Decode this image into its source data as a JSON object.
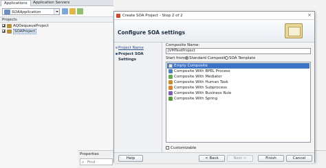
{
  "tabs": [
    "Applications",
    "Application Servers"
  ],
  "application_selector": {
    "value": "SOAApplication"
  },
  "projects_label": "Projects",
  "tree": [
    {
      "label": "AQDequeueProject",
      "selected": false
    },
    {
      "label": "SOAProject",
      "selected": true
    }
  ],
  "properties": {
    "title": "Properties",
    "find_placeholder": "Find"
  },
  "dialog": {
    "title": "Create SOA Project - Step 2 of 2",
    "close_glyph": "×",
    "banner_title": "Configure SOA settings",
    "nav": [
      {
        "label": "Project Name",
        "state": "link"
      },
      {
        "label": "Project SOA Settings",
        "state": "current"
      }
    ],
    "composite_name_label": "Composite Name:",
    "composite_name_value": "JVMTestProject",
    "start_from_label": "Start from:",
    "start_options": [
      {
        "label": "Standard Composite",
        "selected": true
      },
      {
        "label": "SOA Template",
        "selected": false
      }
    ],
    "composites": [
      {
        "label": "Empty Composite",
        "selected": true,
        "icon": "empty-composite-icon",
        "color": "#e8e8e8"
      },
      {
        "label": "Composite With BPEL Process",
        "selected": false,
        "icon": "bpel-icon",
        "color": "#4f7fbf"
      },
      {
        "label": "Composite With Mediator",
        "selected": false,
        "icon": "mediator-icon",
        "color": "#6aa84f"
      },
      {
        "label": "Composite With Human Task",
        "selected": false,
        "icon": "human-task-icon",
        "color": "#c98b2e"
      },
      {
        "label": "Composite With Subprocess",
        "selected": false,
        "icon": "subprocess-icon",
        "color": "#d9822b"
      },
      {
        "label": "Composite With Business Rule",
        "selected": false,
        "icon": "business-rule-icon",
        "color": "#7f5fb3"
      },
      {
        "label": "Composite With Spring",
        "selected": false,
        "icon": "spring-icon",
        "color": "#5a9b3c"
      }
    ],
    "customizable_label": "Customizable",
    "buttons": {
      "help": "Help",
      "back": "< Back",
      "next": "Next >",
      "finish": "Finish",
      "cancel": "Cancel"
    }
  }
}
